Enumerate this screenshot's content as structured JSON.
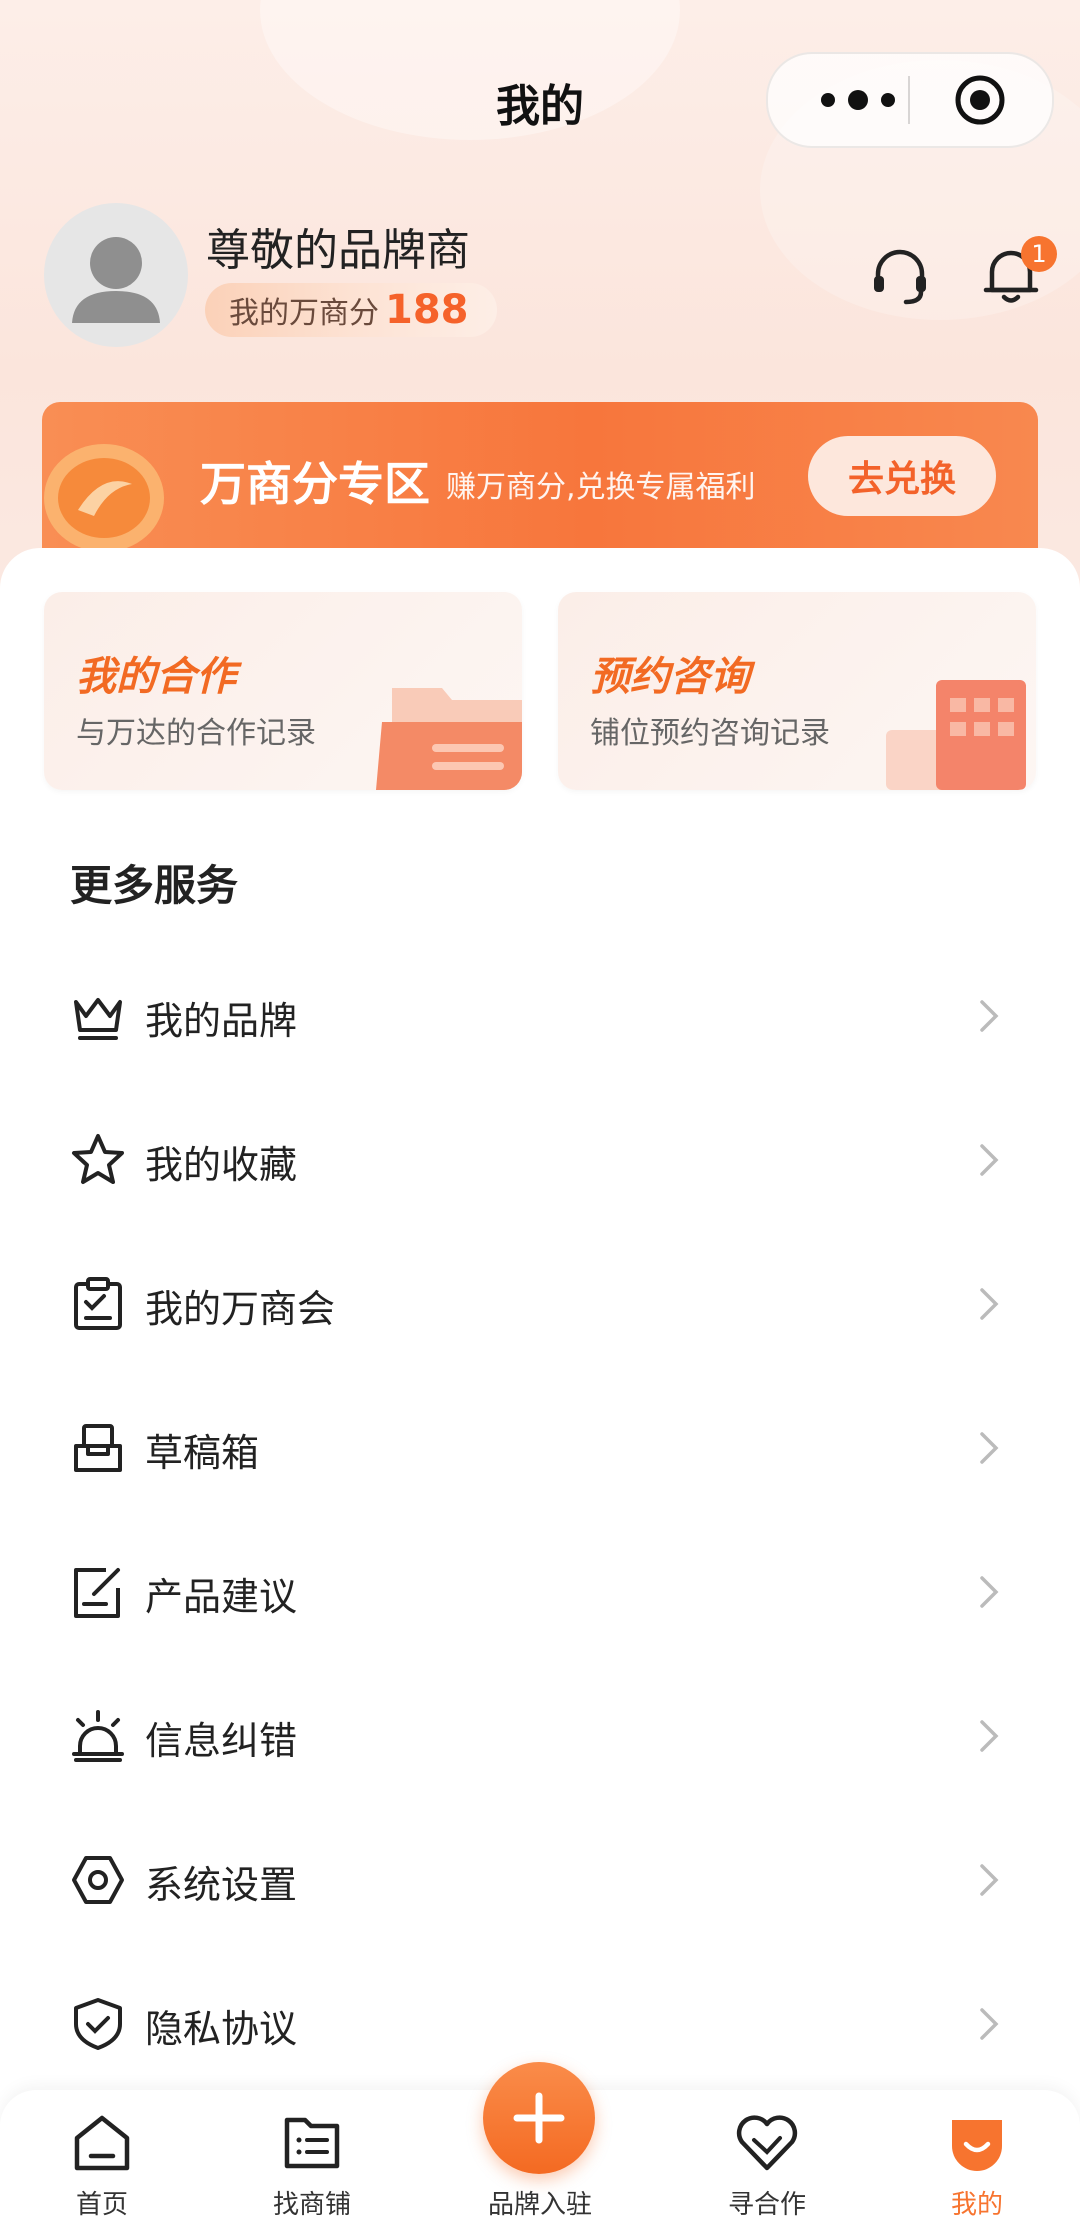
{
  "header": {
    "title": "我的"
  },
  "profile": {
    "name": "尊敬的品牌商",
    "score_label": "我的万商分",
    "score_value": "188",
    "notification_count": "1"
  },
  "banner": {
    "title": "万商分专区",
    "subtitle": "赚万商分,兑换专属福利",
    "button": "去兑换"
  },
  "quick_cards": [
    {
      "title": "我的合作",
      "subtitle": "与万达的合作记录"
    },
    {
      "title": "预约咨询",
      "subtitle": "铺位预约咨询记录"
    }
  ],
  "services": {
    "title": "更多服务",
    "items": [
      {
        "label": "我的品牌",
        "icon": "crown-icon"
      },
      {
        "label": "我的收藏",
        "icon": "star-icon"
      },
      {
        "label": "我的万商会",
        "icon": "clipboard-icon"
      },
      {
        "label": "草稿箱",
        "icon": "inbox-icon"
      },
      {
        "label": "产品建议",
        "icon": "edit-icon"
      },
      {
        "label": "信息纠错",
        "icon": "alarm-icon"
      },
      {
        "label": "系统设置",
        "icon": "settings-icon"
      },
      {
        "label": "隐私协议",
        "icon": "shield-icon"
      }
    ]
  },
  "tabbar": {
    "tabs": [
      {
        "label": "首页",
        "icon": "home-icon"
      },
      {
        "label": "找商铺",
        "icon": "list-icon"
      },
      {
        "label": "品牌入驻",
        "icon": "plus-icon"
      },
      {
        "label": "寻合作",
        "icon": "handshake-heart-icon"
      },
      {
        "label": "我的",
        "icon": "profile-icon"
      }
    ],
    "active": "我的"
  },
  "colors": {
    "accent": "#f7742f",
    "banner_start": "#f98e54",
    "banner_end": "#f7763c",
    "text_primary": "#222222"
  }
}
